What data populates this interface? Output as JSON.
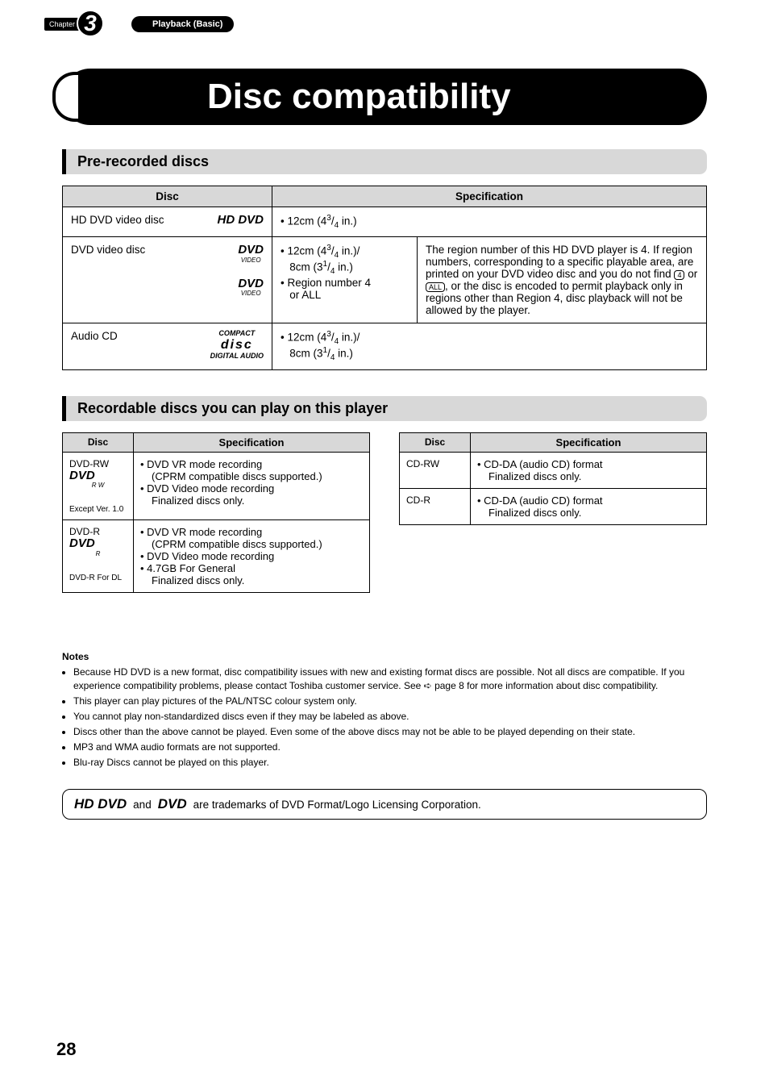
{
  "header": {
    "chapter_label": "Chapter",
    "chapter_number": "3",
    "section_label": "Playback (Basic)"
  },
  "title": "Disc compatibility",
  "pre_recorded": {
    "heading": "Pre-recorded discs",
    "col_disc": "Disc",
    "col_spec": "Specification",
    "rows": [
      {
        "name": "HD DVD video disc",
        "logo": "HD DVD",
        "spec": "• 12cm (4 3/4 in.)",
        "note": ""
      },
      {
        "name": "DVD video disc",
        "logo": "DVD VIDEO",
        "spec_lines": [
          "• 12cm (4 3/4 in.)/",
          "   8cm (3 1/4 in.)",
          "• Region number 4",
          "   or ALL"
        ],
        "note": "The region number of this HD DVD player is 4. If region numbers, corresponding to a specific playable area, are printed on your DVD video disc and you do not find 4 or ALL, or the disc is encoded to permit playback only in regions other than Region 4, disc playback will not be allowed by the player."
      },
      {
        "name": "Audio CD",
        "logo": "COMPACT DISC DIGITAL AUDIO",
        "spec_lines": [
          "• 12cm (4 3/4 in.)/",
          "   8cm (3 1/4 in.)"
        ],
        "note": ""
      }
    ]
  },
  "recordable": {
    "heading": "Recordable discs you can play on this player",
    "col_disc": "Disc",
    "col_spec": "Specification",
    "left": [
      {
        "name": "DVD-RW",
        "sub": "Except Ver. 1.0",
        "spec_lines": [
          "• DVD VR mode recording",
          "   (CPRM compatible discs supported.)",
          "• DVD Video mode recording",
          "   Finalized discs only."
        ]
      },
      {
        "name": "DVD-R",
        "sub": "DVD-R For DL",
        "spec_lines": [
          "• DVD VR mode recording",
          "   (CPRM compatible discs supported.)",
          "• DVD Video mode recording",
          "• 4.7GB For General",
          "   Finalized discs only."
        ]
      }
    ],
    "right": [
      {
        "name": "CD-RW",
        "spec_lines": [
          "• CD-DA (audio CD) format",
          "   Finalized discs only."
        ]
      },
      {
        "name": "CD-R",
        "spec_lines": [
          "• CD-DA (audio CD) format",
          "   Finalized discs only."
        ]
      }
    ]
  },
  "notes": {
    "heading": "Notes",
    "items": [
      "Because HD DVD is a new format, disc compatibility issues with new and existing format discs are possible. Not all discs are compatible. If you experience compatibility problems, please contact Toshiba customer service. See ▶ page 8 for more information about disc compatibility.",
      "This player can play pictures of the PAL/NTSC colour system only.",
      "You cannot play non-standardized discs even if they may be labeled as above.",
      "Discs other than the above cannot be played. Even some of the above discs may not be able to be played depending on their state.",
      "MP3 and WMA audio formats are not supported.",
      "Blu-ray Discs cannot be played on this player."
    ]
  },
  "trademark": {
    "logo1": "HD DVD",
    "and": "and",
    "logo2": "DVD",
    "text": "are trademarks of DVD Format/Logo Licensing Corporation."
  },
  "page_number": "28"
}
